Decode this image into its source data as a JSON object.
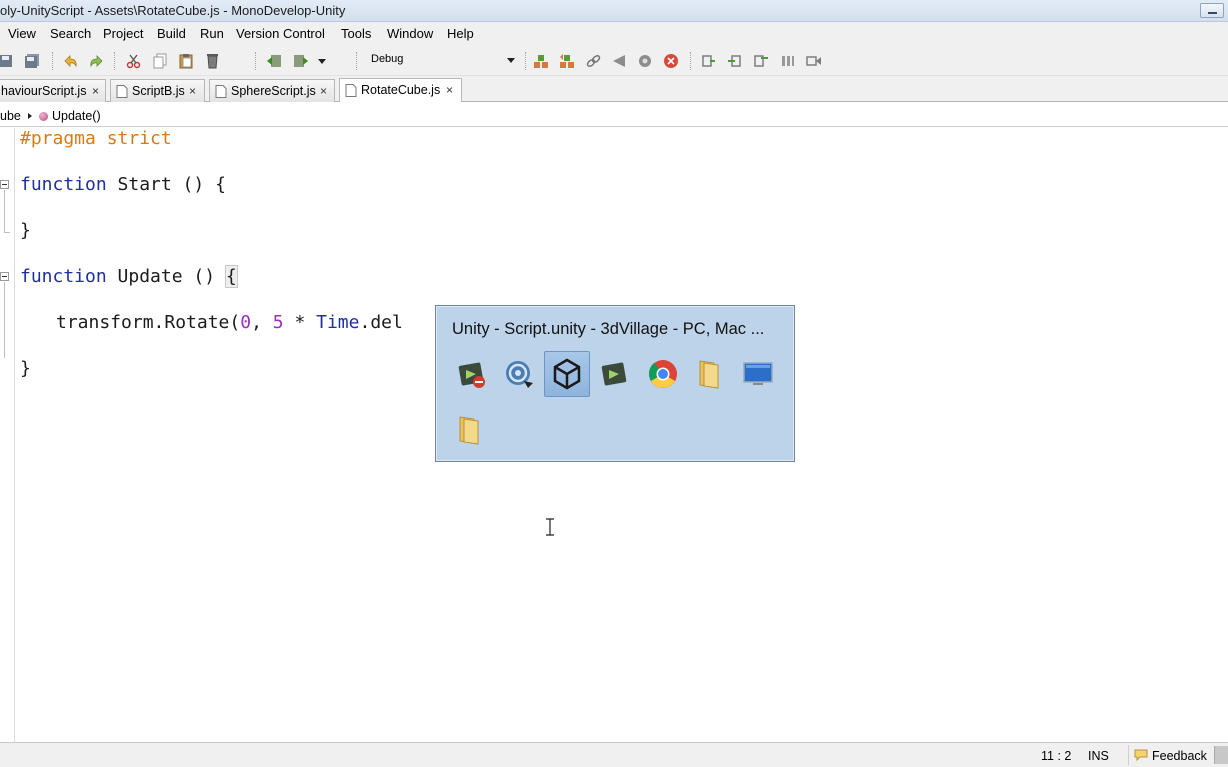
{
  "window": {
    "title": "oly-UnityScript - Assets\\RotateCube.js - MonoDevelop-Unity"
  },
  "menu": {
    "items": [
      "View",
      "Search",
      "Project",
      "Build",
      "Run",
      "Version Control",
      "Tools",
      "Window",
      "Help"
    ]
  },
  "toolbar": {
    "configuration": "Debug",
    "icons": [
      "save-all-icon",
      "save-icon",
      "undo-icon",
      "redo-icon",
      "cut-icon",
      "copy-icon",
      "paste-icon",
      "delete-icon",
      "back-icon",
      "forward-icon",
      "build-icon",
      "rebuild-icon",
      "attach-icon",
      "run-icon",
      "debug-icon",
      "stop-icon",
      "step-over-icon",
      "step-into-icon",
      "step-out-icon",
      "pause-icon",
      "continue-icon"
    ]
  },
  "tabs": [
    {
      "label": "haviourScript.js",
      "active": false
    },
    {
      "label": "ScriptB.js",
      "active": false
    },
    {
      "label": "SphereScript.js",
      "active": false
    },
    {
      "label": "RotateCube.js",
      "active": true
    }
  ],
  "tab_close_glyph": "×",
  "breadcrumb": {
    "class_name": "ube",
    "member_name": "Update()"
  },
  "editor": {
    "lines": {
      "l1": "#pragma strict",
      "l3_kw": "function",
      "l3_rest": " Start () {",
      "l5": "}",
      "l7_kw": "function",
      "l7_rest": " Update () ",
      "l7_brace": "{",
      "l9_a": "transform.Rotate(",
      "l9_n1": "0",
      "l9_b": ", ",
      "l9_n2": "5",
      "l9_c": " * ",
      "l9_t": "Time",
      "l9_d": ".del",
      "l11": "}"
    }
  },
  "taskbar_popup": {
    "title": "Unity - Script.unity - 3dVillage - PC, Mac ...",
    "apps": [
      "unity-error-icon",
      "monodevelop-icon",
      "unity-icon",
      "unity-editor-icon",
      "chrome-icon",
      "folder-icon",
      "monitor-icon",
      "folder-icon"
    ],
    "selected_index": 2
  },
  "statusbar": {
    "position": "11 : 2",
    "mode": "INS",
    "feedback": "Feedback"
  },
  "colors": {
    "keyword": "#1f2ea1",
    "preprocessor": "#d97a19",
    "number": "#9b2fc0",
    "popup_bg": "#bcd3ea"
  }
}
